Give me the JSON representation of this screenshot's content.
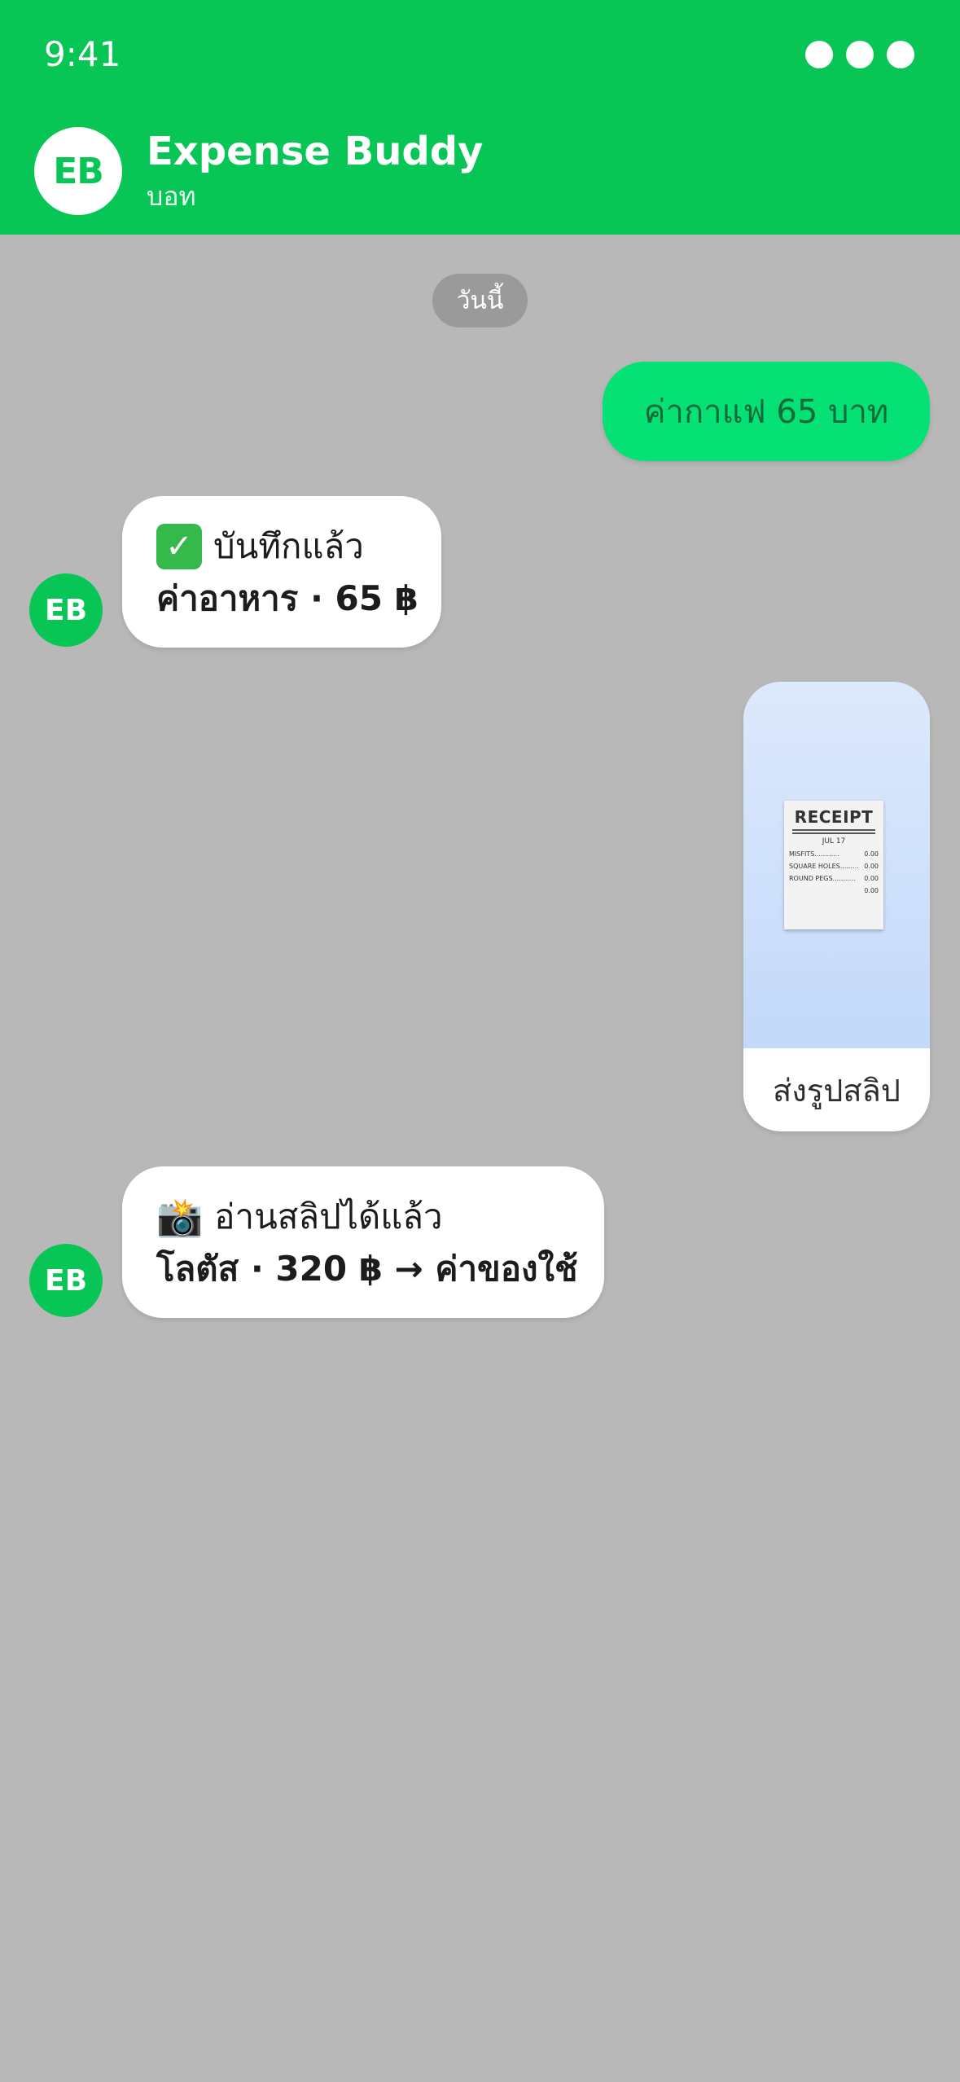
{
  "status_bar": {
    "time": "9:41"
  },
  "header": {
    "avatar_initials": "EB",
    "title": "Expense Buddy",
    "subtitle": "บอท"
  },
  "date_divider": "วันนี้",
  "messages": [
    {
      "sender": "user",
      "text": "ค่ากาแฟ 65 บาท"
    },
    {
      "sender": "bot",
      "avatar_initials": "EB",
      "icon": "check-mark-button-icon",
      "line1": "บันทึกแล้ว",
      "line2": "ค่าอาหาร · 65 ฿"
    },
    {
      "sender": "user",
      "type": "image",
      "image": {
        "title": "RECEIPT",
        "date": "JUL 17",
        "rows": [
          {
            "label": "MISFITS............",
            "value": "0.00"
          },
          {
            "label": "SQUARE HOLES.........",
            "value": "0.00"
          },
          {
            "label": "ROUND PEGS...........",
            "value": "0.00"
          },
          {
            "label": "",
            "value": "0.00"
          }
        ]
      },
      "caption": "ส่งรูปสลิป"
    },
    {
      "sender": "bot",
      "avatar_initials": "EB",
      "icon": "camera-flash-icon",
      "line1": "อ่านสลิปได้แล้ว",
      "line2": "โลตัส · 320 ฿ → ค่าของใช้"
    }
  ],
  "colors": {
    "brand_green": "#08c655",
    "user_bubble": "#06e176",
    "background": "#b8b8b8"
  }
}
